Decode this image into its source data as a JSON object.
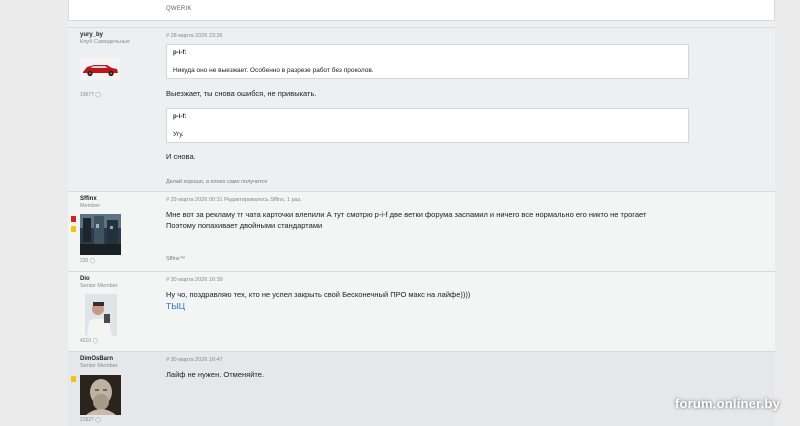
{
  "top_signature": "QWERIK",
  "posts": [
    {
      "author": "yury_by",
      "rank": "Клуб Самодельных",
      "count": "19677",
      "date": "# 28 марта 2026 23:26",
      "quotes": [
        {
          "author": "p-i-f:",
          "text": "Никуда оно не выезжает. Особенно в разрезе работ без проколов."
        },
        {
          "author": "p-i-f:",
          "text": "Угу."
        }
      ],
      "lines": [
        "Выезжает, ты снова ошибся, не привыкать.",
        "И снова."
      ],
      "signature": "Делай хорошо, а плохо само получится"
    },
    {
      "author": "Sffinx",
      "rank": "Member",
      "count": "230",
      "date": "# 29 марта 2026 00:31",
      "edited": "Редактировалось Sffinx, 1 раз.",
      "lines": [
        "Мне вот за рекламу тг чата карточки влепили А тут смотрю p-i-f две ветки форума заспамил и ничего все нормально его никто не трогает",
        "Поэтому попахивает двойными стандартами"
      ],
      "signature": "Sffinx™"
    },
    {
      "author": "Dio",
      "rank": "Senior Member",
      "count": "4210",
      "date": "# 30 марта 2026 16:39",
      "lines": [
        "Ну чо, поздравляю тех, кто не успел закрыть свой Бесконечный ПРО макс на лайфе))))"
      ],
      "link": "ТЫЦ"
    },
    {
      "author": "DimOsBarn",
      "rank": "Senior Member",
      "count": "21627",
      "date": "# 30 марта 2026 16:47",
      "lines": [
        "Лайф не нужен. Отменяйте."
      ]
    }
  ],
  "watermark": "forum.onliner.by",
  "colors": {
    "badge_red": "#d32222",
    "badge_yellow": "#f0c419",
    "link": "#2a6ebb"
  }
}
